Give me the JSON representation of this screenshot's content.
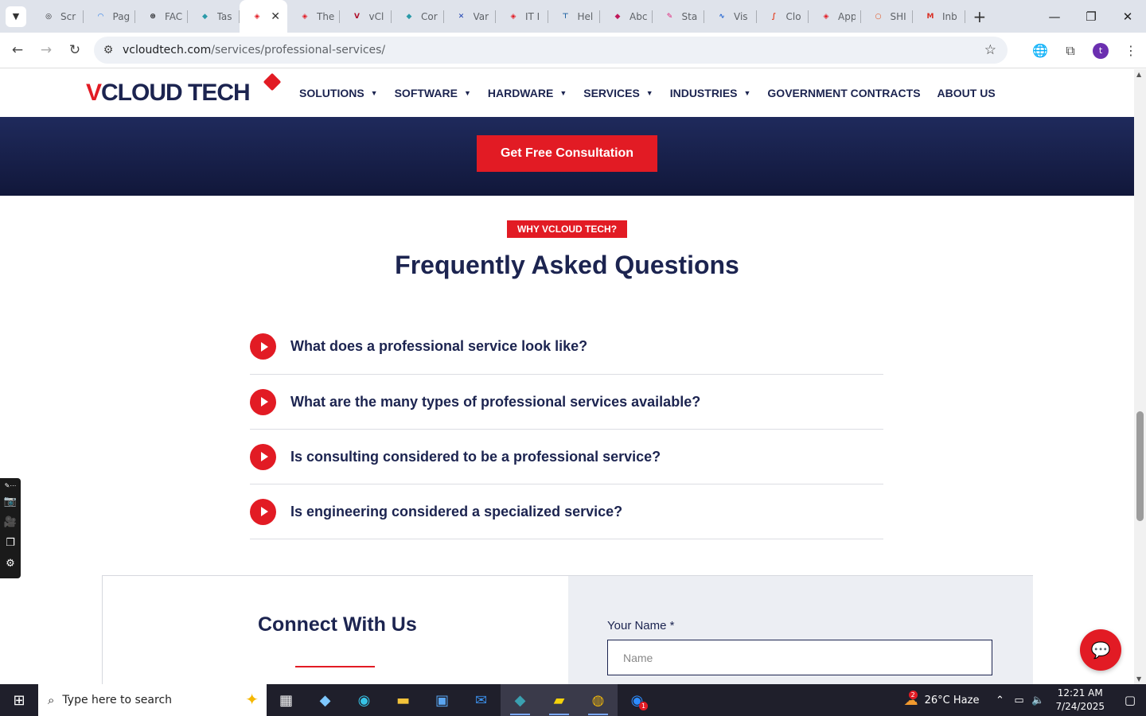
{
  "browser": {
    "tabs": [
      {
        "title": "Scr",
        "color": "#202124",
        "glyph": "◎"
      },
      {
        "title": "Pag",
        "color": "#1a73e8",
        "glyph": "◠"
      },
      {
        "title": "FAC",
        "color": "#202124",
        "glyph": "⊛"
      },
      {
        "title": "Tas",
        "color": "#2b9aa8",
        "glyph": "◆"
      },
      {
        "title": "",
        "color": "#e21b24",
        "glyph": "◈",
        "active": true
      },
      {
        "title": "The",
        "color": "#e21b24",
        "glyph": "◈"
      },
      {
        "title": "vCl",
        "color": "#b0102a",
        "glyph": "V"
      },
      {
        "title": "Cor",
        "color": "#2b9aa8",
        "glyph": "◆"
      },
      {
        "title": "Var",
        "color": "#1a3fb0",
        "glyph": "✕"
      },
      {
        "title": "IT I",
        "color": "#e21b24",
        "glyph": "◈"
      },
      {
        "title": "Hel",
        "color": "#1a5fa0",
        "glyph": "⊤"
      },
      {
        "title": "Abc",
        "color": "#c0185a",
        "glyph": "◆"
      },
      {
        "title": "Sta",
        "color": "#e0237a",
        "glyph": "✎"
      },
      {
        "title": "Vis",
        "color": "#1a5fd0",
        "glyph": "∿"
      },
      {
        "title": "Clo",
        "color": "#e23a1b",
        "glyph": "∫"
      },
      {
        "title": "App",
        "color": "#e21b24",
        "glyph": "◈"
      },
      {
        "title": "SHI",
        "color": "#e2501b",
        "glyph": "○"
      },
      {
        "title": "Inb",
        "color": "#d93025",
        "glyph": "M"
      }
    ],
    "url_host": "vcloudtech.com",
    "url_path": "/services/professional-services/",
    "profile_initial": "t"
  },
  "site": {
    "logo_part1": "V",
    "logo_part2": "CLOUD TECH",
    "menu": [
      {
        "label": "SOLUTIONS",
        "dropdown": true
      },
      {
        "label": "SOFTWARE",
        "dropdown": true
      },
      {
        "label": "HARDWARE",
        "dropdown": true
      },
      {
        "label": "SERVICES",
        "dropdown": true
      },
      {
        "label": "INDUSTRIES",
        "dropdown": true
      },
      {
        "label": "GOVERNMENT CONTRACTS",
        "dropdown": false
      },
      {
        "label": "ABOUT US",
        "dropdown": false
      }
    ],
    "cta_label": "Get Free Consultation",
    "badge": "WHY VCLOUD TECH?",
    "faq_title": "Frequently Asked Questions",
    "faqs": [
      "What does a professional service look like?",
      "What are the many types of professional services available?",
      "Is consulting considered to be a professional service?",
      "Is engineering considered a specialized service?"
    ],
    "connect_title": "Connect With Us",
    "name_label": "Your Name *",
    "name_placeholder": "Name",
    "accent": "#e21b24",
    "navy": "#1c2450"
  },
  "taskbar": {
    "search_placeholder": "Type here to search",
    "weather_badge": "2",
    "weather": "26°C  Haze",
    "time": "12:21 AM",
    "date": "7/24/2025",
    "zoom_badge": "1"
  }
}
